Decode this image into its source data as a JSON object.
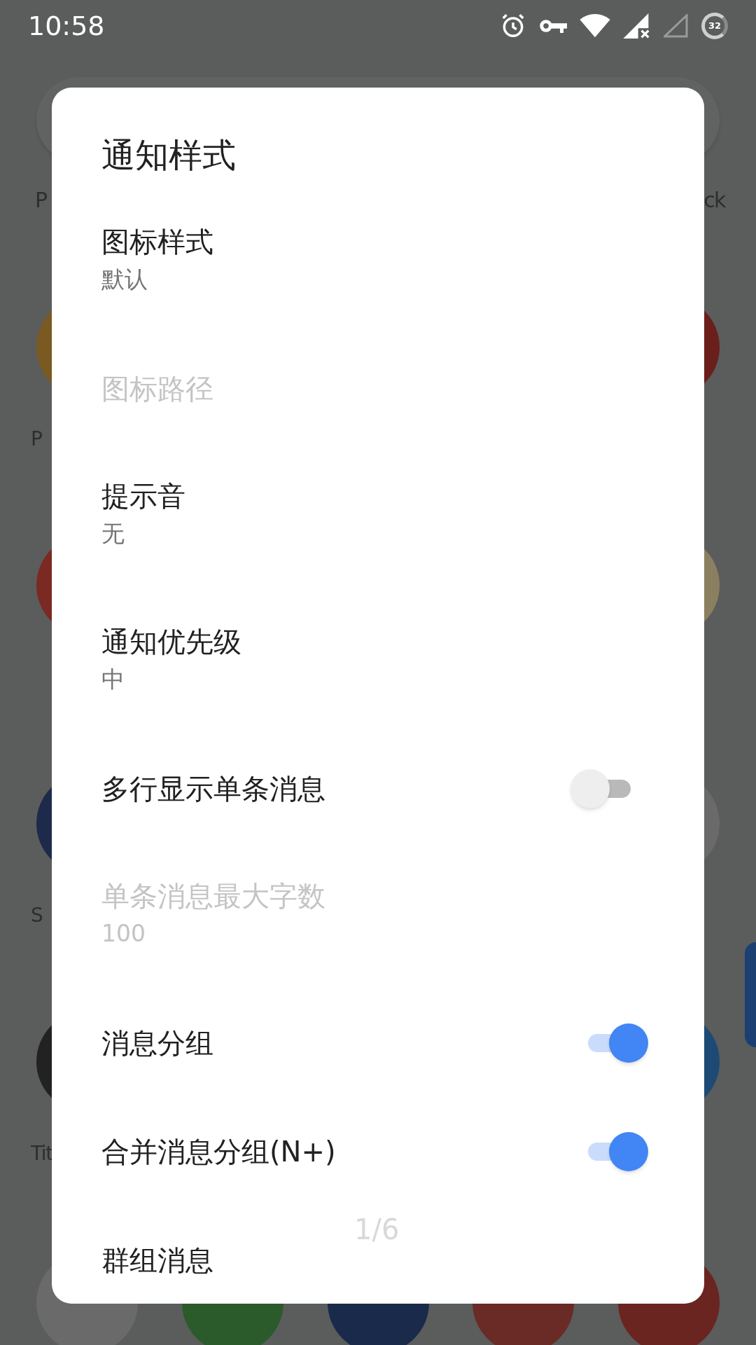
{
  "status_bar": {
    "time": "10:58",
    "battery": "32"
  },
  "home": {
    "top_labels": [
      "P",
      "ck"
    ],
    "rows": [
      {
        "left": {
          "color": "#7a5a22",
          "label": "P"
        },
        "right": {
          "color": "#6a1f1b"
        }
      },
      {
        "left": {
          "color": "#7a2a22"
        },
        "right": {
          "color": "#8a8060"
        }
      },
      {
        "left": {
          "color": "#1e2a4a",
          "label": "S"
        },
        "right": {
          "color": "#6a6a6a"
        }
      },
      {
        "left": {
          "color": "#222222",
          "label": "Tit"
        },
        "right": {
          "color": "#1d4a75"
        }
      }
    ],
    "dock": [
      {
        "color": "#6a6a6a"
      },
      {
        "color": "#2b5a2b"
      },
      {
        "color": "#1a2a4a"
      },
      {
        "color": "#6a2a26"
      },
      {
        "color": "#6a2520"
      }
    ]
  },
  "dialog": {
    "title": "通知样式",
    "items": [
      {
        "kind": "pref",
        "title": "图标样式",
        "summary": "默认",
        "disabled": false
      },
      {
        "kind": "pref",
        "title": "图标路径",
        "disabled": true
      },
      {
        "kind": "pref",
        "title": "提示音",
        "summary": "无",
        "disabled": false
      },
      {
        "kind": "pref",
        "title": "通知优先级",
        "summary": "中",
        "disabled": false
      },
      {
        "kind": "switch",
        "title": "多行显示单条消息",
        "on": false,
        "disabled": false
      },
      {
        "kind": "pref",
        "title": "单条消息最大字数",
        "summary": "100",
        "disabled": true
      },
      {
        "kind": "switch",
        "title": "消息分组",
        "on": true,
        "disabled": false
      },
      {
        "kind": "switch",
        "title": "合并消息分组(N+)",
        "on": true,
        "disabled": false
      },
      {
        "kind": "pref",
        "title": "群组消息",
        "disabled": false
      }
    ],
    "page_indicator": "1/6"
  }
}
